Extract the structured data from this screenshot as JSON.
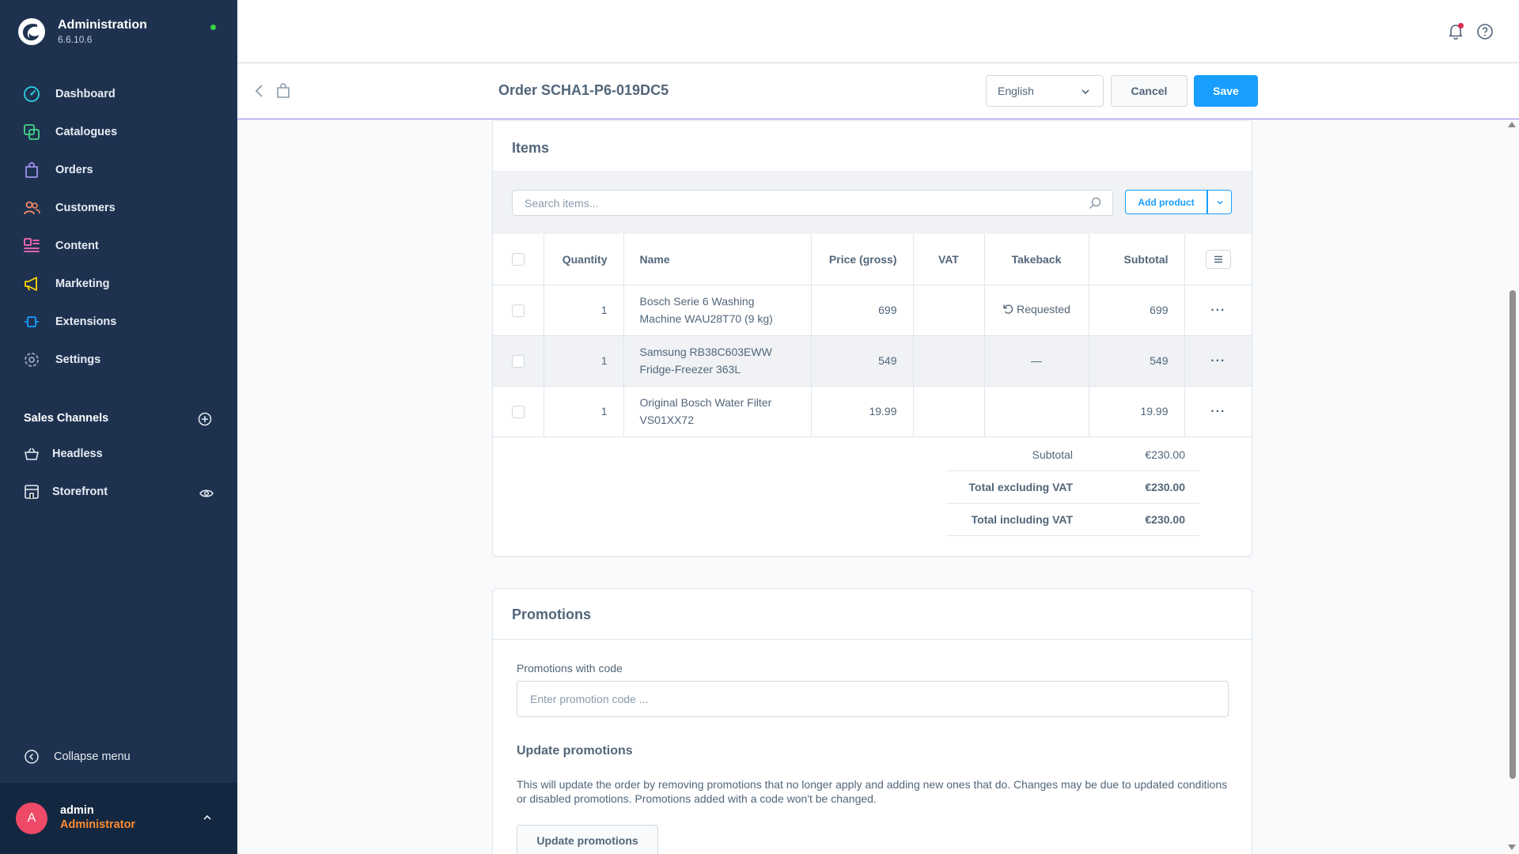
{
  "app": {
    "title": "Administration",
    "version": "6.6.10.6",
    "status_color": "#37d046"
  },
  "sidebar": {
    "items": [
      {
        "label": "Dashboard",
        "icon": "dashboard-icon",
        "color": "#2bd4e6"
      },
      {
        "label": "Catalogues",
        "icon": "catalogues-icon",
        "color": "#44d685"
      },
      {
        "label": "Orders",
        "icon": "orders-icon",
        "color": "#a092f0"
      },
      {
        "label": "Customers",
        "icon": "customers-icon",
        "color": "#f88962"
      },
      {
        "label": "Content",
        "icon": "content-icon",
        "color": "#ff68b4"
      },
      {
        "label": "Marketing",
        "icon": "marketing-icon",
        "color": "#ffd700"
      },
      {
        "label": "Extensions",
        "icon": "extensions-icon",
        "color": "#189eff"
      },
      {
        "label": "Settings",
        "icon": "settings-icon",
        "color": "#9aa8b5"
      }
    ],
    "sales_channels_title": "Sales Channels",
    "channels": [
      {
        "label": "Headless",
        "icon": "basket-icon"
      },
      {
        "label": "Storefront",
        "icon": "storefront-icon"
      }
    ],
    "collapse_label": "Collapse menu",
    "user": {
      "initial": "A",
      "name": "admin",
      "role": "Administrator"
    }
  },
  "smartbar": {
    "title": "Order SCHA1-P6-019DC5",
    "language": "English",
    "cancel_label": "Cancel",
    "save_label": "Save"
  },
  "items": {
    "title": "Items",
    "search_placeholder": "Search items...",
    "add_product_label": "Add product",
    "columns": [
      "Quantity",
      "Name",
      "Price (gross)",
      "VAT",
      "Takeback",
      "Subtotal"
    ],
    "rows": [
      {
        "quantity": "1",
        "name_line1": "Bosch Serie 6 Washing",
        "name_line2": "Machine WAU28T70 (9 kg)",
        "price": "699",
        "vat": "",
        "takeback": "Requested",
        "subtotal": "699"
      },
      {
        "quantity": "1",
        "name_line1": "Samsung RB38C603EWW",
        "name_line2": "Fridge-Freezer 363L",
        "price": "549",
        "vat": "",
        "takeback": "—",
        "subtotal": "549"
      },
      {
        "quantity": "1",
        "name_line1": "Original Bosch Water Filter",
        "name_line2": "VS01XX72",
        "price": "19.99",
        "vat": "",
        "takeback": "",
        "subtotal": "19.99"
      }
    ],
    "row_action": "···",
    "totals": [
      {
        "label": "Subtotal",
        "value": "€230.00"
      },
      {
        "label": "Total excluding VAT",
        "value": "€230.00"
      },
      {
        "label": "Total including VAT",
        "value": "€230.00"
      }
    ]
  },
  "promotions": {
    "title": "Promotions",
    "code_label": "Promotions with code",
    "code_placeholder": "Enter promotion code ...",
    "update_title": "Update promotions",
    "update_description": "This will update the order by removing promotions that no longer apply and adding new ones that do. Changes may be due to updated conditions or disabled promotions. Promotions added with a code won't be changed.",
    "update_button": "Update promotions"
  }
}
